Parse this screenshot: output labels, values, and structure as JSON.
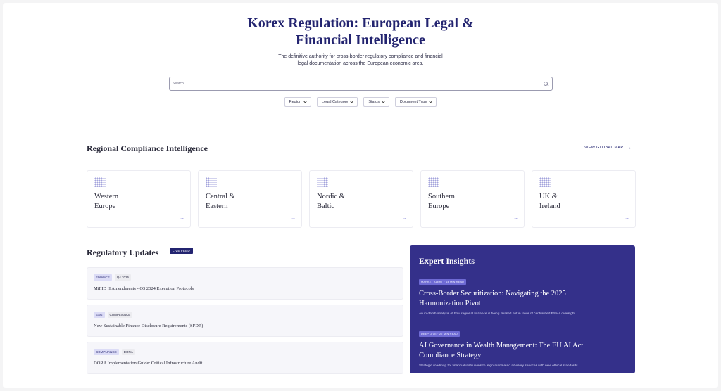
{
  "hero": {
    "title_line1": "Korex Regulation: European Legal &",
    "title_line2": "Financial Intelligence",
    "subtitle_line1": "The definitive authority for cross-border regulatory compliance and financial",
    "subtitle_line2": "legal documentation across the European economic area."
  },
  "search": {
    "placeholder": "Search",
    "icon": "search-icon"
  },
  "filters": [
    {
      "label": "Region"
    },
    {
      "label": "Legal Category"
    },
    {
      "label": "Status"
    },
    {
      "label": "Document Type"
    }
  ],
  "regional": {
    "title": "Regional Compliance Intelligence",
    "view_map_label": "VIEW GLOBAL MAP",
    "cards": [
      {
        "line1": "Western",
        "line2": "Europe"
      },
      {
        "line1": "Central &",
        "line2": "Eastern"
      },
      {
        "line1": "Nordic &",
        "line2": "Baltic"
      },
      {
        "line1": "Southern",
        "line2": "Europe"
      },
      {
        "line1": "UK &",
        "line2": "Ireland"
      }
    ]
  },
  "updates": {
    "title": "Regulatory Updates",
    "live_badge": "LIVE FEED",
    "items": [
      {
        "tag1": "FINANCE",
        "tag2": "Q4 2025",
        "title": "MiFID II Amendments - Q3 2024 Execution Protocols"
      },
      {
        "tag1": "ESG",
        "tag2": "COMPLIANCE",
        "title": "New Sustainable Finance Disclosure Requirements (SFDR)"
      },
      {
        "tag1": "COMPLIANCE",
        "tag2": "DORA",
        "title": "DORA Implementation Guide: Critical Infrastructure Audit"
      }
    ]
  },
  "expert": {
    "title": "Expert Insights",
    "items": [
      {
        "badge": "MARKET ALERT · 14 MIN READ",
        "title_line1": "Cross-Border Securitization: Navigating the 2025",
        "title_line2": "Harmonization Pivot",
        "description": "An in-depth analysis of how regional variance is being phased out in favor of centralized ESMA oversight."
      },
      {
        "badge": "DEEP DIVE · 22 MIN READ",
        "title_line1": "AI Governance in Wealth Management: The EU AI Act",
        "title_line2": "Compliance Strategy",
        "description": "Strategic roadmap for financial institutions to align automated advisory services with new ethical standards."
      }
    ]
  },
  "colors": {
    "accent": "#232470",
    "panel": "#34308a",
    "badge": "#6e6ad4"
  }
}
